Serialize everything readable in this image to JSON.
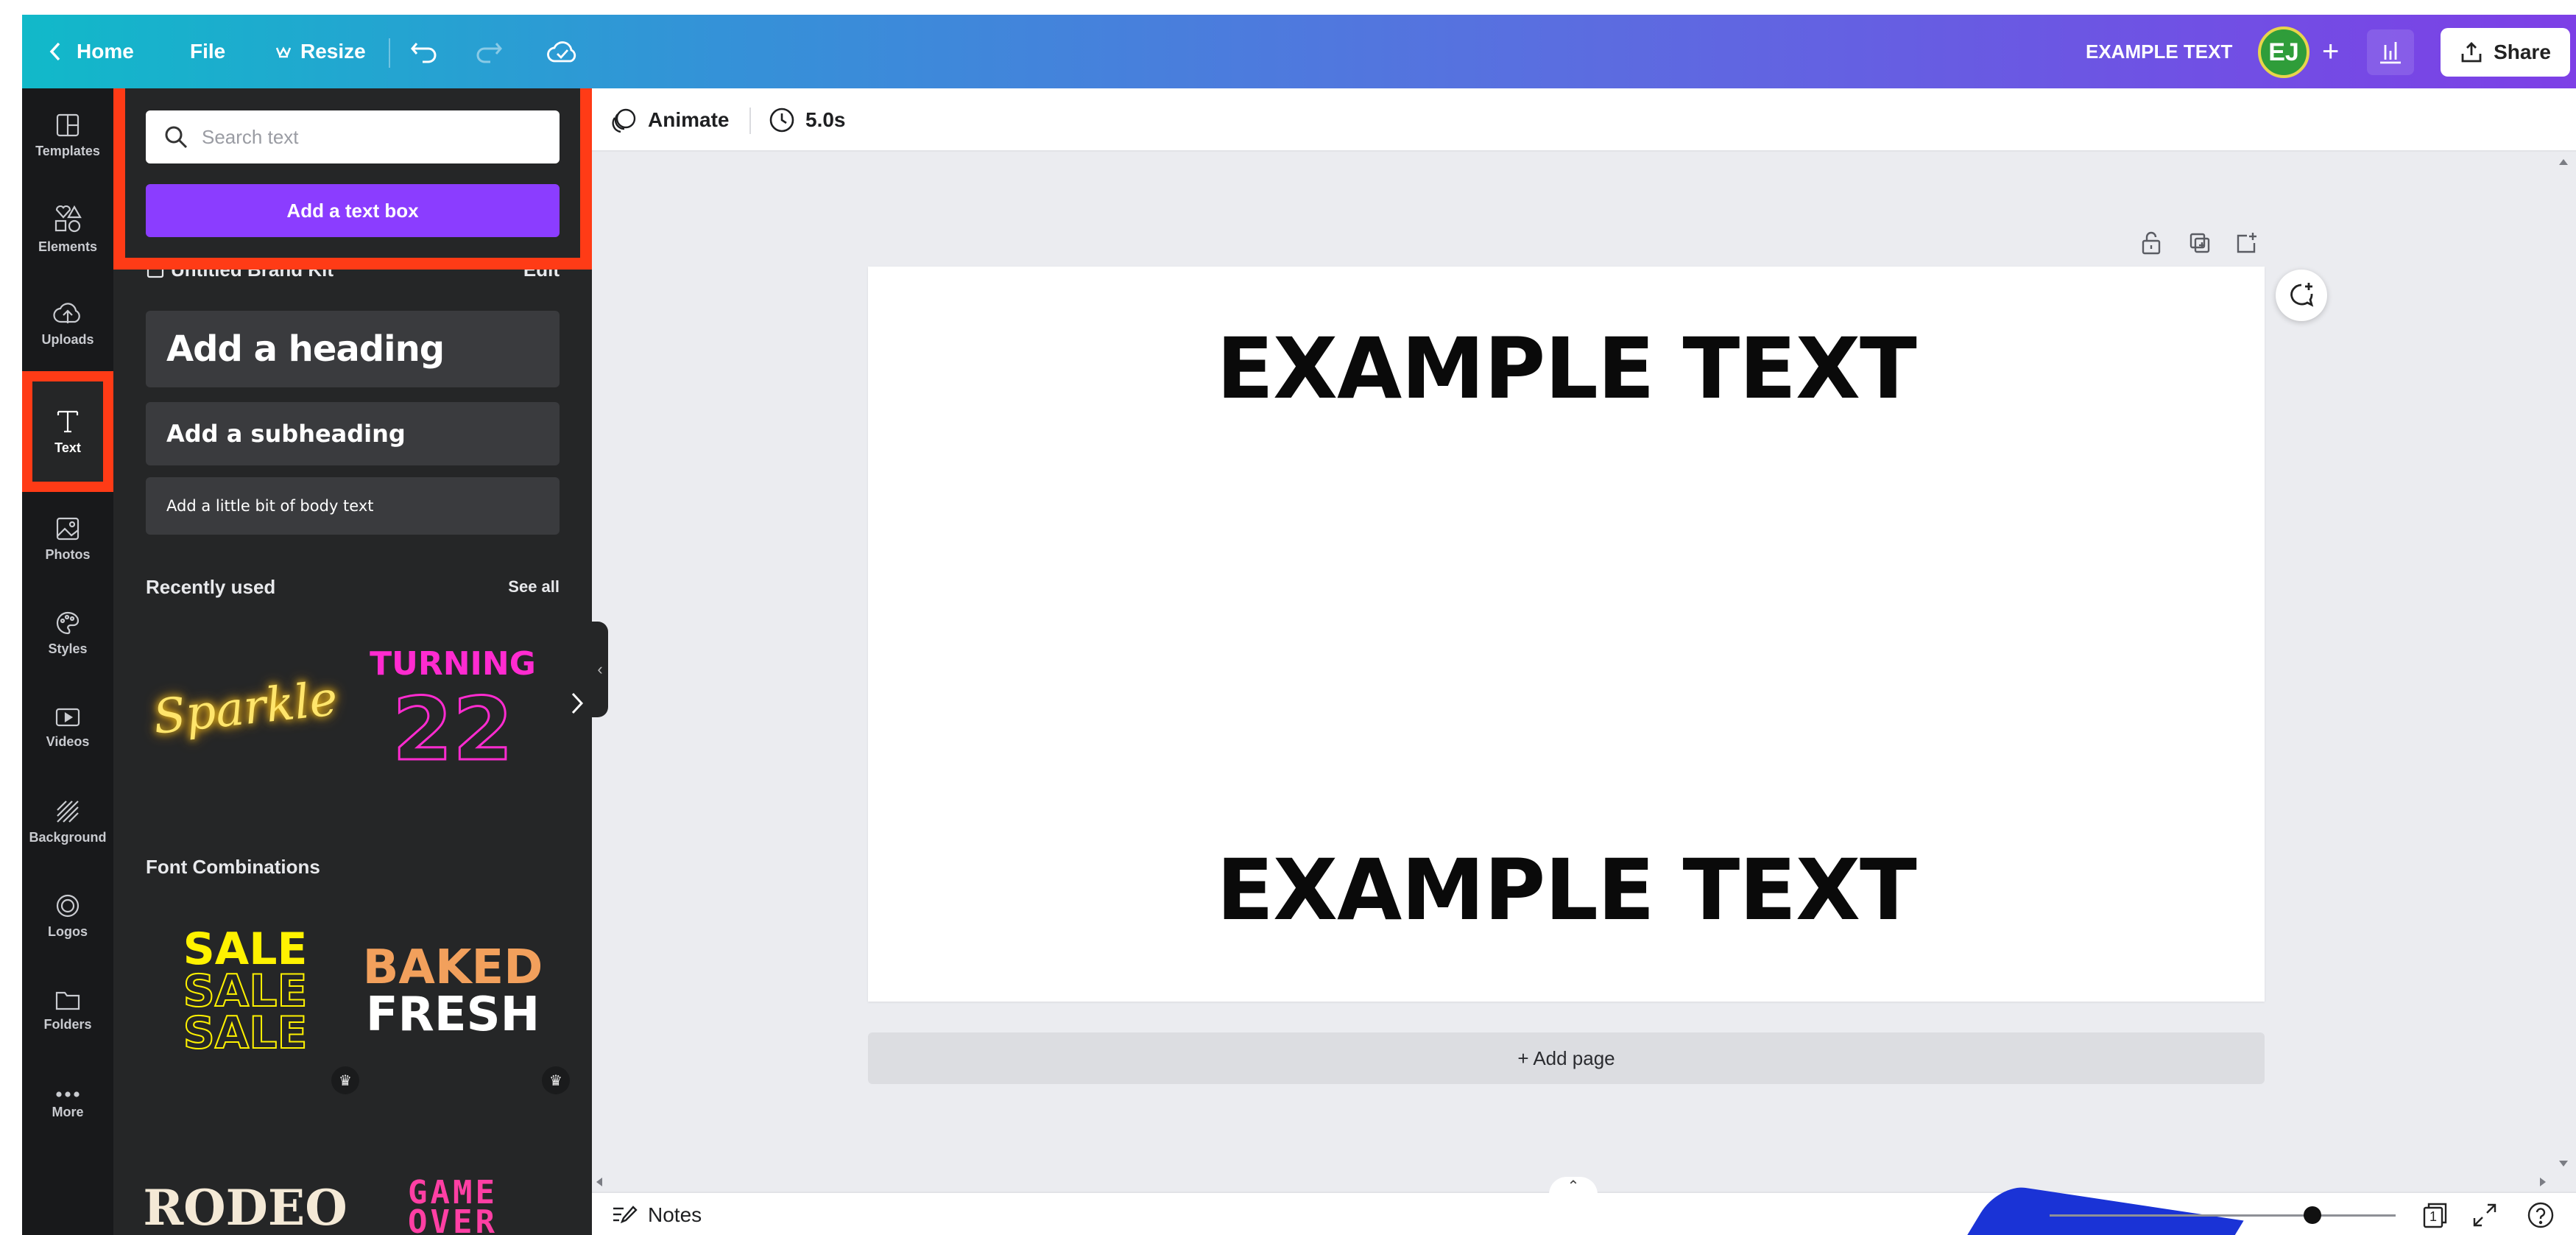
{
  "topbar": {
    "home_label": "Home",
    "file_label": "File",
    "resize_label": "Resize",
    "design_title": "EXAMPLE TEXT",
    "avatar_initials": "EJ",
    "share_label": "Share"
  },
  "rail": {
    "items": [
      {
        "label": "Templates",
        "icon": "templates-icon"
      },
      {
        "label": "Elements",
        "icon": "elements-icon"
      },
      {
        "label": "Uploads",
        "icon": "uploads-icon"
      },
      {
        "label": "Text",
        "icon": "text-icon"
      },
      {
        "label": "Photos",
        "icon": "photos-icon"
      },
      {
        "label": "Styles",
        "icon": "styles-icon"
      },
      {
        "label": "Videos",
        "icon": "videos-icon"
      },
      {
        "label": "Background",
        "icon": "background-icon"
      },
      {
        "label": "Logos",
        "icon": "logos-icon"
      },
      {
        "label": "Folders",
        "icon": "folders-icon"
      },
      {
        "label": "More",
        "icon": "more-icon"
      }
    ],
    "active": "Text"
  },
  "panel": {
    "search_placeholder": "Search text",
    "add_textbox_label": "Add a text box",
    "brand_kit_label": "Untitled Brand Kit",
    "brand_kit_edit": "Edit",
    "heading_label": "Add a heading",
    "subheading_label": "Add a subheading",
    "body_label": "Add a little bit of body text",
    "recently_used_title": "Recently used",
    "see_all_label": "See all",
    "recent_items": [
      "Sparkle",
      "TURNING",
      "22"
    ],
    "font_combinations_title": "Font Combinations",
    "combo_items": {
      "sale": "SALE",
      "baked": "BAKED",
      "fresh": "FRESH",
      "rodeo": "RODEO",
      "game": "GAME",
      "over": "OVER"
    }
  },
  "canvas": {
    "animate_label": "Animate",
    "duration_label": "5.0s",
    "page_text_top": "EXAMPLE TEXT",
    "page_text_bottom": "EXAMPLE TEXT",
    "add_page_label": "+ Add page"
  },
  "bottombar": {
    "notes_label": "Notes",
    "page_count": "1"
  },
  "colors": {
    "accent": "#8b3dff",
    "highlight": "#ff3b16",
    "panel_bg": "#252627",
    "rail_bg": "#18191b"
  }
}
